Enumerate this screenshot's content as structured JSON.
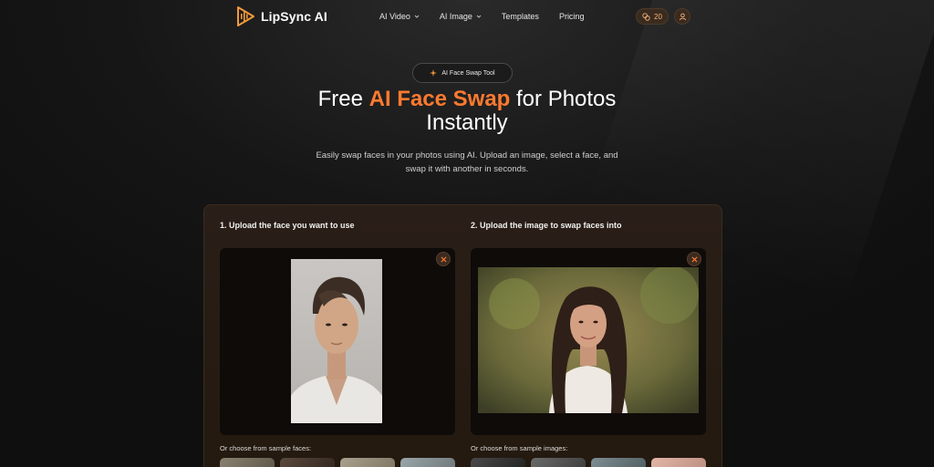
{
  "nav": {
    "logo_text": "LipSync AI",
    "items": [
      {
        "label": "AI Video",
        "has_dropdown": true
      },
      {
        "label": "AI Image",
        "has_dropdown": true
      },
      {
        "label": "Templates",
        "has_dropdown": false
      },
      {
        "label": "Pricing",
        "has_dropdown": false
      }
    ],
    "credits": "20",
    "icons": {
      "credits": "coins-icon",
      "user": "user-icon"
    }
  },
  "hero": {
    "badge": "AI Face Swap Tool",
    "title_prefix": "Free ",
    "title_accent": "AI Face Swap",
    "title_suffix": " for Photos",
    "title_line2": "Instantly",
    "subtitle": "Easily swap faces in your photos using AI. Upload an image, select a face, and swap it with another in seconds."
  },
  "steps": {
    "face": {
      "label": "1. Upload the face you want to use",
      "samples_label": "Or choose from sample faces:",
      "image": "uploaded-face-photo"
    },
    "target": {
      "label": "2. Upload the image to swap faces into",
      "samples_label": "Or choose from sample images:",
      "image": "uploaded-target-photo"
    }
  },
  "colors": {
    "accent": "#ff7a2f",
    "panel": "#2a1f18",
    "background": "#161616"
  }
}
